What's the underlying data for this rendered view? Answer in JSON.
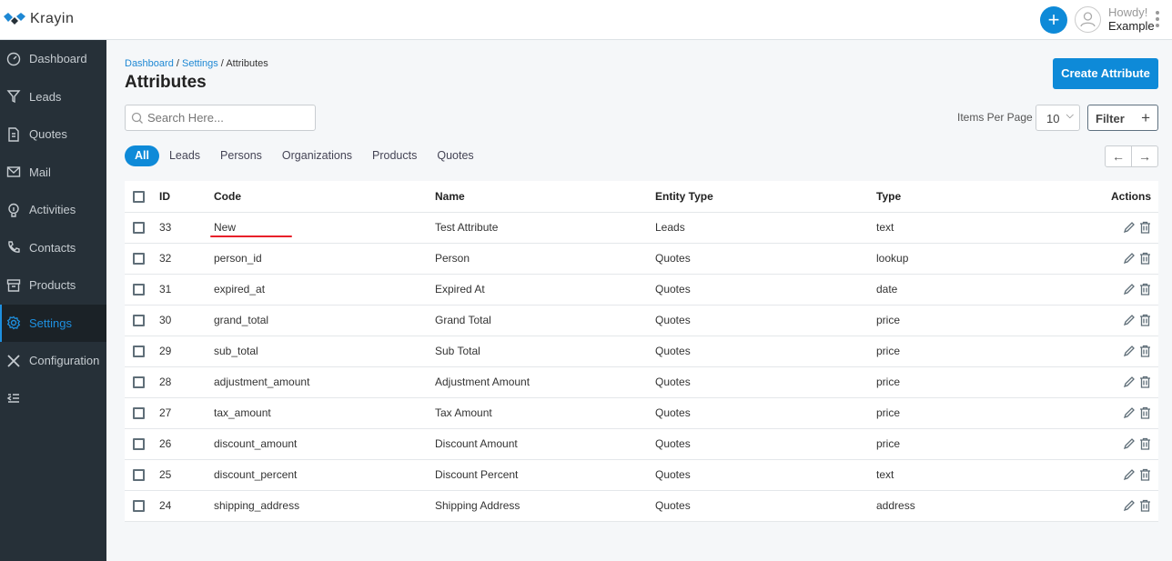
{
  "app": {
    "name": "Krayin"
  },
  "header": {
    "greeting": "Howdy!",
    "user": "Example"
  },
  "sidebar": {
    "items": [
      {
        "label": "Dashboard",
        "icon": "dashboard-icon"
      },
      {
        "label": "Leads",
        "icon": "filter-icon"
      },
      {
        "label": "Quotes",
        "icon": "document-icon"
      },
      {
        "label": "Mail",
        "icon": "mail-icon"
      },
      {
        "label": "Activities",
        "icon": "bulb-icon"
      },
      {
        "label": "Contacts",
        "icon": "phone-icon"
      },
      {
        "label": "Products",
        "icon": "box-icon"
      },
      {
        "label": "Settings",
        "icon": "gear-icon",
        "active": true
      },
      {
        "label": "Configuration",
        "icon": "tools-icon"
      }
    ]
  },
  "breadcrumb": {
    "items": [
      "Dashboard",
      "Settings",
      "Attributes"
    ]
  },
  "page": {
    "title": "Attributes",
    "create_label": "Create Attribute"
  },
  "search": {
    "placeholder": "Search Here...",
    "value": ""
  },
  "pagination": {
    "items_per_page_label": "Items Per Page",
    "items_per_page": "10"
  },
  "filter": {
    "label": "Filter"
  },
  "tabs": [
    "All",
    "Leads",
    "Persons",
    "Organizations",
    "Products",
    "Quotes"
  ],
  "active_tab": "All",
  "table": {
    "columns": [
      "ID",
      "Code",
      "Name",
      "Entity Type",
      "Type",
      "Actions"
    ],
    "rows": [
      [
        "33",
        "New",
        "Test Attribute",
        "Leads",
        "text"
      ],
      [
        "32",
        "person_id",
        "Person",
        "Quotes",
        "lookup"
      ],
      [
        "31",
        "expired_at",
        "Expired At",
        "Quotes",
        "date"
      ],
      [
        "30",
        "grand_total",
        "Grand Total",
        "Quotes",
        "price"
      ],
      [
        "29",
        "sub_total",
        "Sub Total",
        "Quotes",
        "price"
      ],
      [
        "28",
        "adjustment_amount",
        "Adjustment Amount",
        "Quotes",
        "price"
      ],
      [
        "27",
        "tax_amount",
        "Tax Amount",
        "Quotes",
        "price"
      ],
      [
        "26",
        "discount_amount",
        "Discount Amount",
        "Quotes",
        "price"
      ],
      [
        "25",
        "discount_percent",
        "Discount Percent",
        "Quotes",
        "text"
      ],
      [
        "24",
        "shipping_address",
        "Shipping Address",
        "Quotes",
        "address"
      ]
    ]
  },
  "colors": {
    "accent": "#0e8ad8",
    "sidebar": "#263038",
    "annotation": "#e8202a"
  }
}
